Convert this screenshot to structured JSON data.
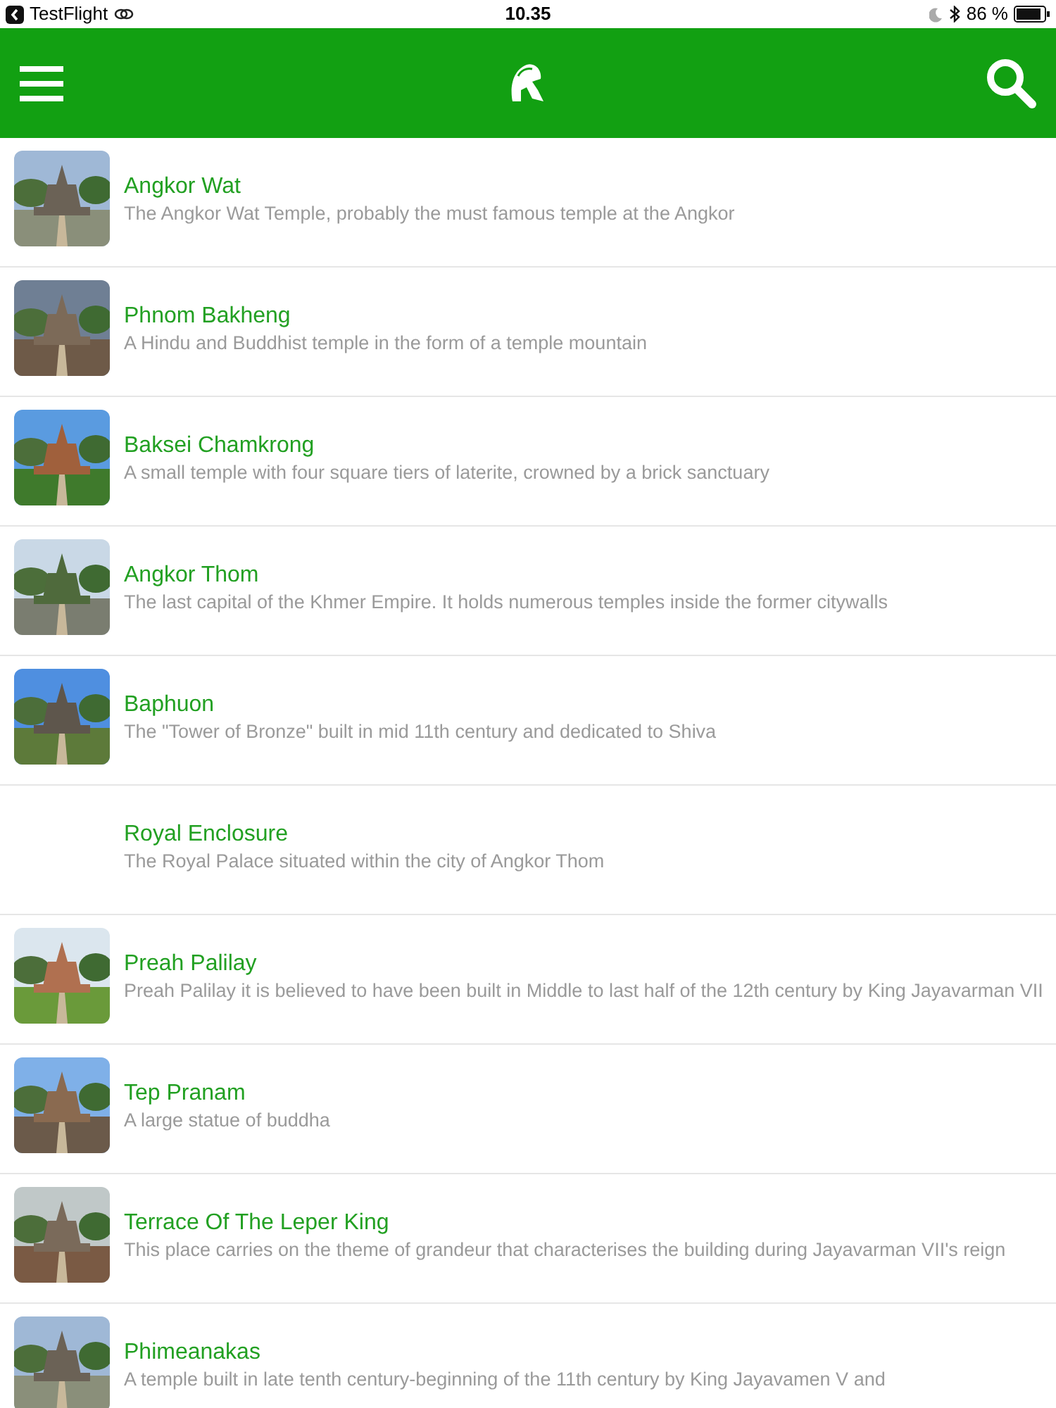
{
  "status_bar": {
    "app": "TestFlight",
    "time": "10.35",
    "battery": "86 %"
  },
  "places": [
    {
      "kind": "picture",
      "title": "Angkor Wat",
      "description": "The Angkor Wat Temple, probably the must famous temple at the Angkor"
    },
    {
      "kind": "picture",
      "title": "Phnom Bakheng",
      "description": "A Hindu and Buddhist temple in the form of a temple mountain"
    },
    {
      "kind": "picture",
      "title": "Baksei Chamkrong",
      "description": "A small temple with four square tiers of laterite, crowned by a brick sanctuary"
    },
    {
      "kind": "picture",
      "title": "Angkor Thom",
      "description": "The last capital of the Khmer Empire. It holds numerous temples inside the former citywalls"
    },
    {
      "kind": "picture",
      "title": "Baphuon",
      "description": "The \"Tower of Bronze\" built in mid 11th century and dedicated to Shiva"
    },
    {
      "kind": "text",
      "title": "Royal Enclosure",
      "description": "The Royal Palace situated within the city of Angkor Thom"
    },
    {
      "kind": "picture",
      "title": "Preah Palilay",
      "description": "Preah Palilay it is believed to have been built in Middle to last half of the 12th century by King Jayavarman VII"
    },
    {
      "kind": "picture",
      "title": "Tep Pranam",
      "description": "A large statue of buddha"
    },
    {
      "kind": "picture",
      "title": "Terrace Of The Leper King",
      "description": "This place carries on the theme of grandeur that characterises the building during Jayavarman VII's reign"
    },
    {
      "kind": "picture",
      "title": "Phimeanakas",
      "description": "A temple built in late tenth century-beginning of the 11th century by King Jayavamen V and"
    }
  ]
}
